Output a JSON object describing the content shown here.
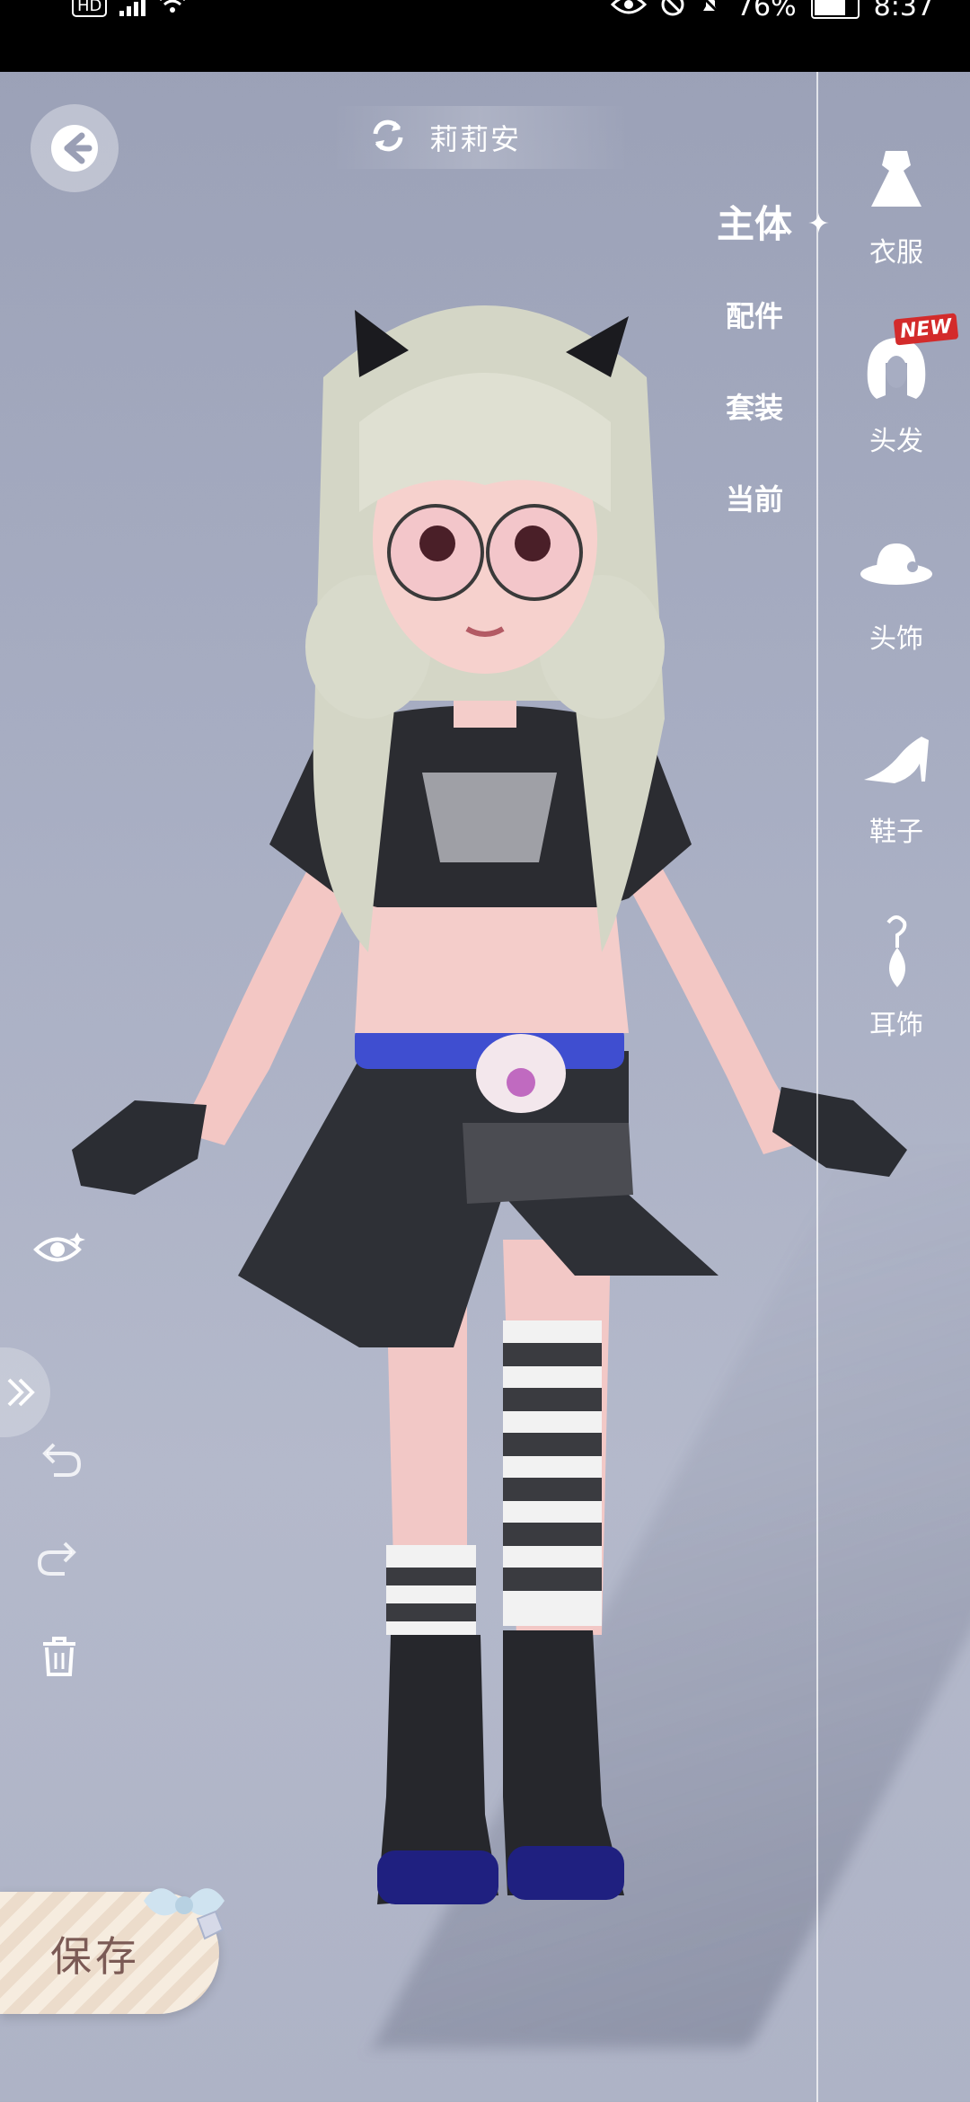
{
  "status_bar": {
    "left_badge": "HD",
    "battery": "76%",
    "time": "8:37"
  },
  "header": {
    "character_name": "莉莉安"
  },
  "category_menu": {
    "items": [
      {
        "label": "主体",
        "active": true
      },
      {
        "label": "配件",
        "active": false
      },
      {
        "label": "套装",
        "active": false
      },
      {
        "label": "当前",
        "active": false
      }
    ]
  },
  "sidebar": {
    "items": [
      {
        "label": "衣服",
        "icon": "dress-icon"
      },
      {
        "label": "头发",
        "icon": "hair-icon",
        "badge": "NEW"
      },
      {
        "label": "头饰",
        "icon": "hat-icon"
      },
      {
        "label": "鞋子",
        "icon": "shoe-icon"
      },
      {
        "label": "耳饰",
        "icon": "earring-icon"
      }
    ]
  },
  "actions": {
    "save_label": "保存"
  },
  "colors": {
    "background": "#a7adc2",
    "new_badge": "#d32b2b",
    "save_text": "#7b5a55"
  }
}
